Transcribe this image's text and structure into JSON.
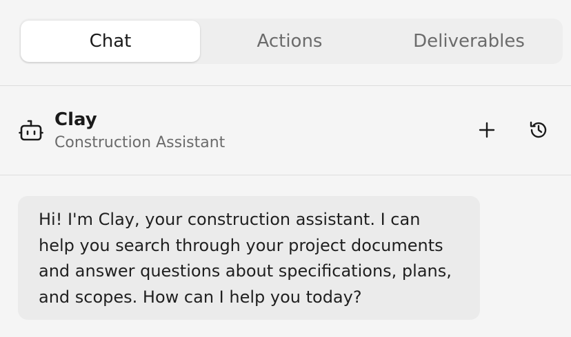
{
  "tabs": [
    {
      "label": "Chat",
      "active": true
    },
    {
      "label": "Actions",
      "active": false
    },
    {
      "label": "Deliverables",
      "active": false
    }
  ],
  "assistant": {
    "name": "Clay",
    "role": "Construction Assistant",
    "icon": "bot-icon"
  },
  "header_actions": {
    "new_icon": "plus-icon",
    "history_icon": "history-icon"
  },
  "messages": [
    {
      "sender": "assistant",
      "text": "Hi! I'm Clay, your construction assistant. I can help you search through your project documents and answer questions about specifications, plans, and scopes. How can I help you today?"
    }
  ],
  "colors": {
    "background": "#f5f5f5",
    "tab_track": "#eeeeee",
    "tab_active": "#ffffff",
    "bubble": "#ebebeb",
    "muted_text": "#6b6b6b"
  }
}
